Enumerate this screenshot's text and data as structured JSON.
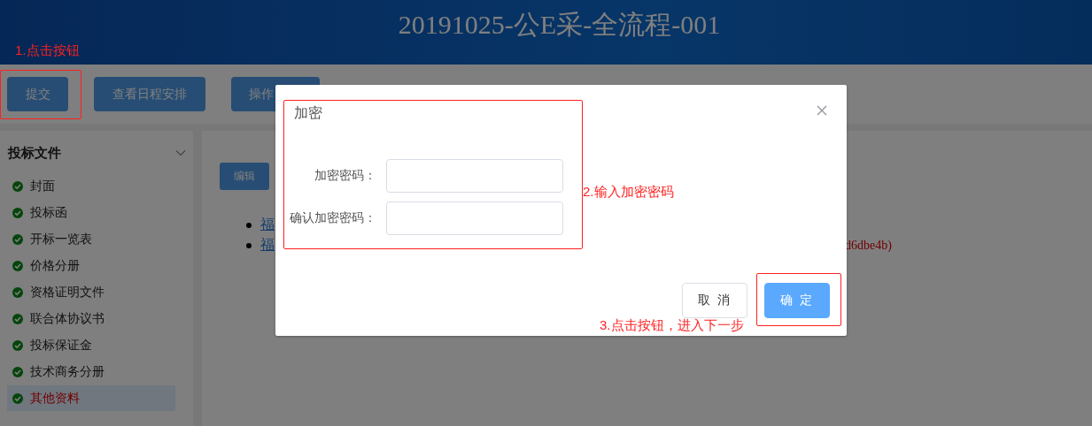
{
  "header": {
    "title": "20191025-公E采-全流程-001"
  },
  "toolbar": {
    "buttons": [
      {
        "label": "提交"
      },
      {
        "label": "查看日程安排"
      },
      {
        "label": "操作"
      }
    ]
  },
  "sidebar": {
    "title": "投标文件",
    "expanded": true,
    "items": [
      {
        "label": "封面",
        "done": true,
        "selected": false
      },
      {
        "label": "投标函",
        "done": true,
        "selected": false
      },
      {
        "label": "开标一览表",
        "done": true,
        "selected": false
      },
      {
        "label": "价格分册",
        "done": true,
        "selected": false
      },
      {
        "label": "资格证明文件",
        "done": true,
        "selected": false
      },
      {
        "label": "联合体协议书",
        "done": true,
        "selected": false
      },
      {
        "label": "投标保证金",
        "done": true,
        "selected": false
      },
      {
        "label": "技术商务分册",
        "done": true,
        "selected": false
      },
      {
        "label": "其他资料",
        "done": true,
        "selected": true
      }
    ]
  },
  "content": {
    "edit_button": "编辑",
    "files": [
      {
        "link": "福"
      },
      {
        "link": "福",
        "note": "d6dbe4b)"
      }
    ]
  },
  "dialog": {
    "title": "加密",
    "fields": [
      {
        "label": "加密密码："
      },
      {
        "label": "确认加密密码："
      }
    ],
    "buttons": [
      {
        "label": "取 消",
        "kind": "default"
      },
      {
        "label": "确 定",
        "kind": "primary"
      }
    ]
  },
  "annotations": [
    {
      "text": "1.点击按钮",
      "kind": "submit"
    },
    {
      "text": "2.输入加密密码",
      "kind": "form"
    },
    {
      "text": "3.点击按钮，进入下一步",
      "kind": "confirm"
    }
  ]
}
